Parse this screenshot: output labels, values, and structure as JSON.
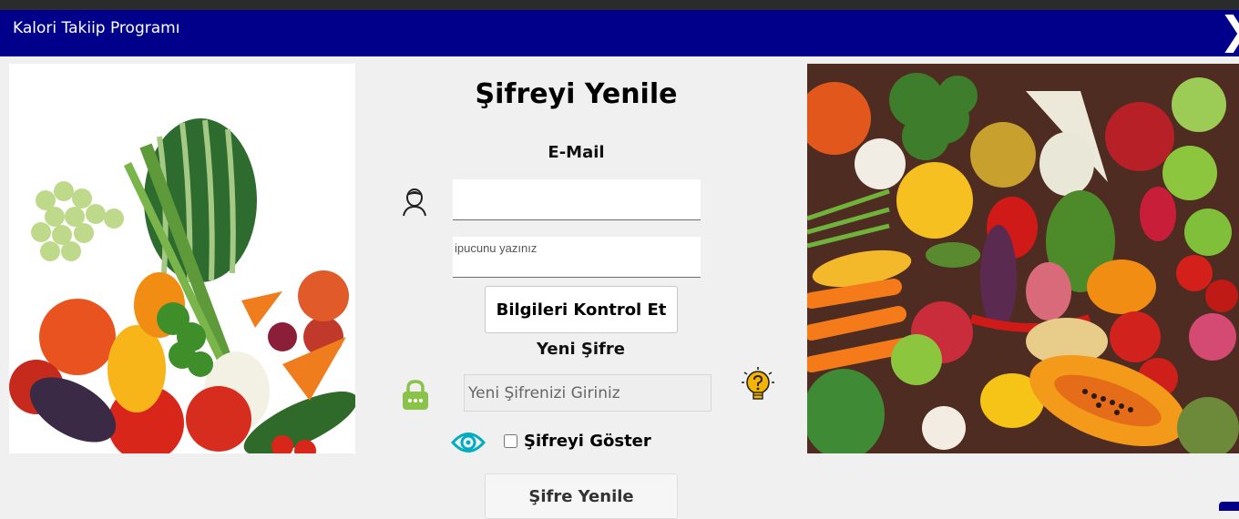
{
  "window": {
    "title": "Kalori Takiip Programı",
    "close_glyph": "❯"
  },
  "form": {
    "heading": "Şifreyi Yenile",
    "email_label": "E-Mail",
    "email_value": "",
    "hint_placeholder": "ipucunu yazınız",
    "check_button": "Bilgileri Kontrol Et",
    "new_password_label": "Yeni Şifre",
    "new_password_placeholder": "Yeni Şifrenizi Giriniz",
    "show_password_label": "Şifreyi Göster",
    "show_password_checked": false,
    "reset_button": "Şifre Yenile"
  },
  "icons": {
    "user": "user-icon",
    "lock": "lock-icon",
    "hint": "lightbulb-question-icon",
    "eye": "eye-icon"
  },
  "colors": {
    "titlebar": "#00008b",
    "lock": "#8bc34a",
    "eye": "#00acc1",
    "bulb": "#f5b400"
  }
}
